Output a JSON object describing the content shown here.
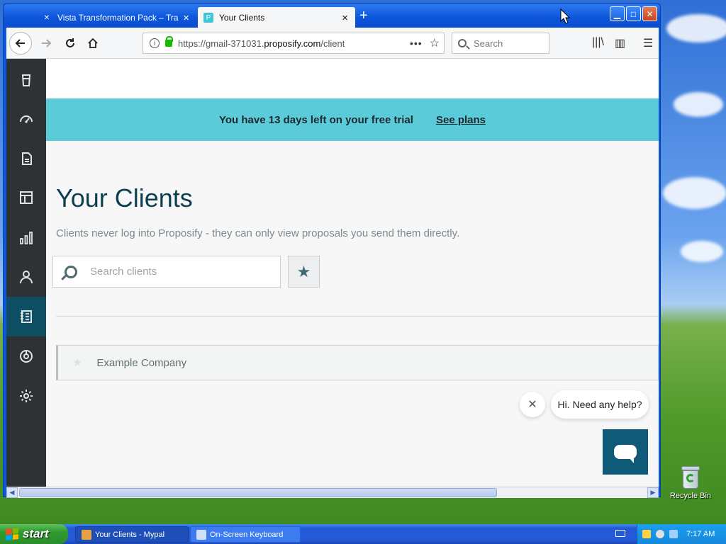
{
  "browser": {
    "tabs": [
      {
        "title": "Vista Transformation Pack – Trans",
        "active": false
      },
      {
        "title": "Your Clients",
        "active": true
      }
    ],
    "url_prefix": "https://gmail-371031.",
    "url_domain": "proposify.com",
    "url_path": "/client",
    "search_placeholder": "Search",
    "window_buttons": [
      "minimize",
      "maximize",
      "close"
    ]
  },
  "sidebar": {
    "items": [
      {
        "icon": "cup-icon",
        "active": false
      },
      {
        "icon": "dashboard-icon",
        "active": false
      },
      {
        "icon": "documents-icon",
        "active": false
      },
      {
        "icon": "templates-icon",
        "active": false
      },
      {
        "icon": "metrics-icon",
        "active": false
      },
      {
        "icon": "user-icon",
        "active": false
      },
      {
        "icon": "clients-book-icon",
        "active": true
      },
      {
        "icon": "integrations-icon",
        "active": false
      },
      {
        "icon": "settings-gear-icon",
        "active": false
      }
    ]
  },
  "banner": {
    "message": "You have 13 days left on your free trial",
    "link": "See plans",
    "color": "#5bcad9"
  },
  "main": {
    "title": "Your Clients",
    "subtitle": "Clients never log into Proposify - they can only view proposals you send them directly.",
    "search_placeholder": "Search clients",
    "clients": [
      {
        "name": "Example Company",
        "starred": false
      }
    ]
  },
  "chat": {
    "help_text": "Hi. Need any help?"
  },
  "desktop": {
    "recycle_bin_label": "Recycle Bin"
  },
  "taskbar": {
    "start_label": "start",
    "items": [
      {
        "label": "Your Clients - Mypal",
        "active": true
      },
      {
        "label": "On-Screen Keyboard",
        "active": false
      }
    ],
    "clock": "7:17 AM"
  },
  "colors": {
    "accent_dark": "#0e4f63",
    "heading": "#0d3f50",
    "sidebar_bg": "#2f3232"
  }
}
